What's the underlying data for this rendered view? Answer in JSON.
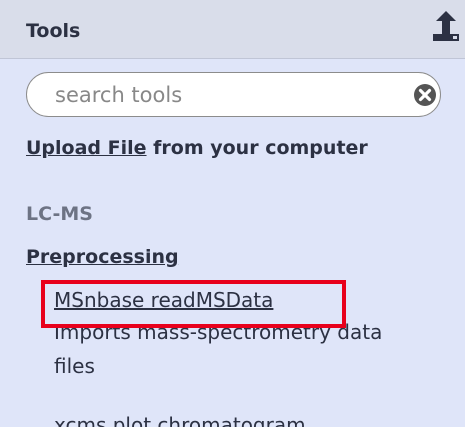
{
  "panel": {
    "title": "Tools",
    "upload_icon": "upload-icon"
  },
  "search": {
    "placeholder": "search tools",
    "value": "",
    "clear_icon": "clear-icon"
  },
  "upload": {
    "link_label": "Upload File",
    "suffix": " from your computer"
  },
  "sections": [
    {
      "label": "LC-MS",
      "categories": [
        {
          "label": "Preprocessing",
          "tools": [
            {
              "name": "MSnbase readMSData",
              "description": "Imports mass-spectrometry data files",
              "highlighted": true
            },
            {
              "name": "xcms plot chromatogram",
              "description": "",
              "highlighted": false
            }
          ]
        }
      ]
    }
  ],
  "colors": {
    "highlight": "#e8001c",
    "panel_background": "#dfe5f9",
    "header_background": "#d9ddea",
    "text": "#2c3143",
    "section_text": "#6d7384"
  }
}
